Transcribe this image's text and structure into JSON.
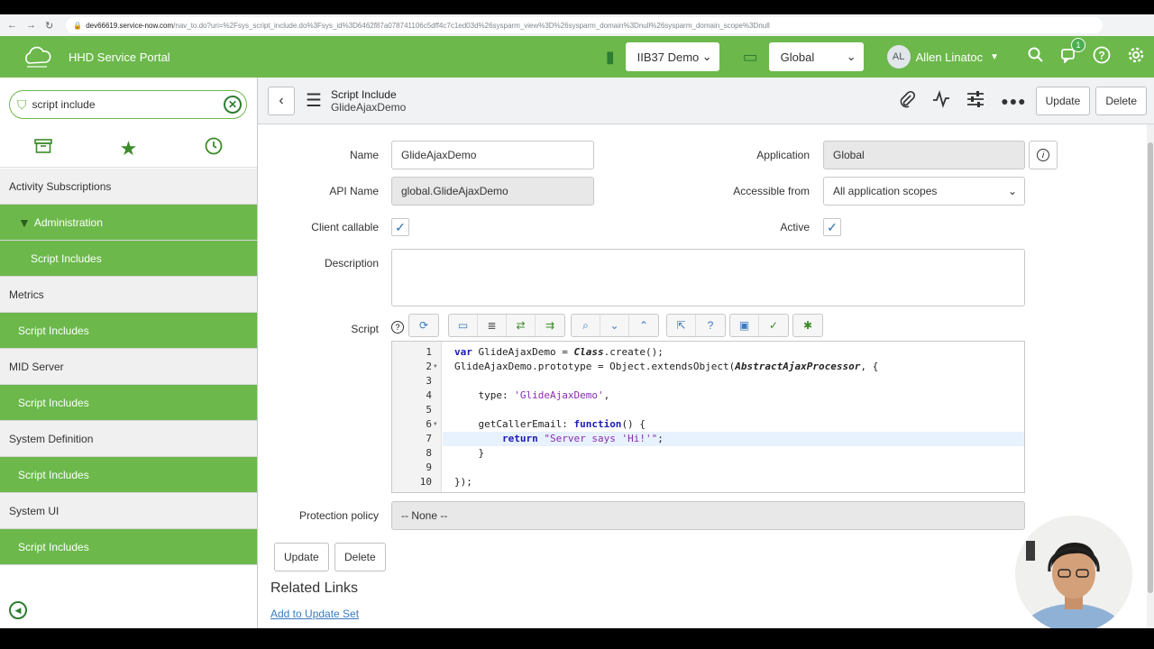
{
  "browser": {
    "url_host": "dev66619.service-now.com",
    "url_path": "/nav_to.do?uri=%2Fsys_script_include.do%3Fsys_id%3D6462f87a078741106c5dff4c7c1ed03d%26sysparm_view%3D%26sysparm_domain%3Dnull%26sysparm_domain_scope%3Dnull"
  },
  "header": {
    "brand": "HHD Service Portal",
    "update_set": "IIB37 Demo",
    "application_scope": "Global",
    "avatar_initials": "AL",
    "user_name": "Allen Linatoc",
    "chat_badge": "1",
    "brand_color": "#6cb84b"
  },
  "sidebar": {
    "filter_value": "script include",
    "items": [
      {
        "label": "Activity Subscriptions",
        "style": "grey"
      },
      {
        "label": "Administration",
        "style": "green",
        "expanded": true
      },
      {
        "label": "Script Includes",
        "style": "green-sub"
      },
      {
        "label": "Metrics",
        "style": "grey"
      },
      {
        "label": "Script Includes",
        "style": "green"
      },
      {
        "label": "MID Server",
        "style": "grey"
      },
      {
        "label": "Script Includes",
        "style": "green"
      },
      {
        "label": "System Definition",
        "style": "grey"
      },
      {
        "label": "Script Includes",
        "style": "green"
      },
      {
        "label": "System UI",
        "style": "grey"
      },
      {
        "label": "Script Includes",
        "style": "green"
      }
    ]
  },
  "form": {
    "table_label": "Script Include",
    "record_name": "GlideAjaxDemo",
    "update_label": "Update",
    "delete_label": "Delete",
    "fields": {
      "name_label": "Name",
      "name_value": "GlideAjaxDemo",
      "api_name_label": "API Name",
      "api_name_value": "global.GlideAjaxDemo",
      "client_callable_label": "Client callable",
      "client_callable": true,
      "description_label": "Description",
      "description_value": "",
      "application_label": "Application",
      "application_value": "Global",
      "accessible_from_label": "Accessible from",
      "accessible_from_value": "All application scopes",
      "active_label": "Active",
      "active": true,
      "script_label": "Script",
      "protection_policy_label": "Protection policy",
      "protection_policy_value": "-- None --"
    },
    "script_lines": [
      "var GlideAjaxDemo = Class.create();",
      "GlideAjaxDemo.prototype = Object.extendsObject(AbstractAjaxProcessor, {",
      "",
      "    type: 'GlideAjaxDemo',",
      "",
      "    getCallerEmail: function() {",
      "        return \"Server says 'Hi!'\";",
      "    }",
      "",
      "});"
    ],
    "line_numbers": [
      "1",
      "2",
      "3",
      "4",
      "5",
      "6",
      "7",
      "8",
      "9",
      "10"
    ],
    "related_links_title": "Related Links",
    "related_link": "Add to Update Set"
  }
}
